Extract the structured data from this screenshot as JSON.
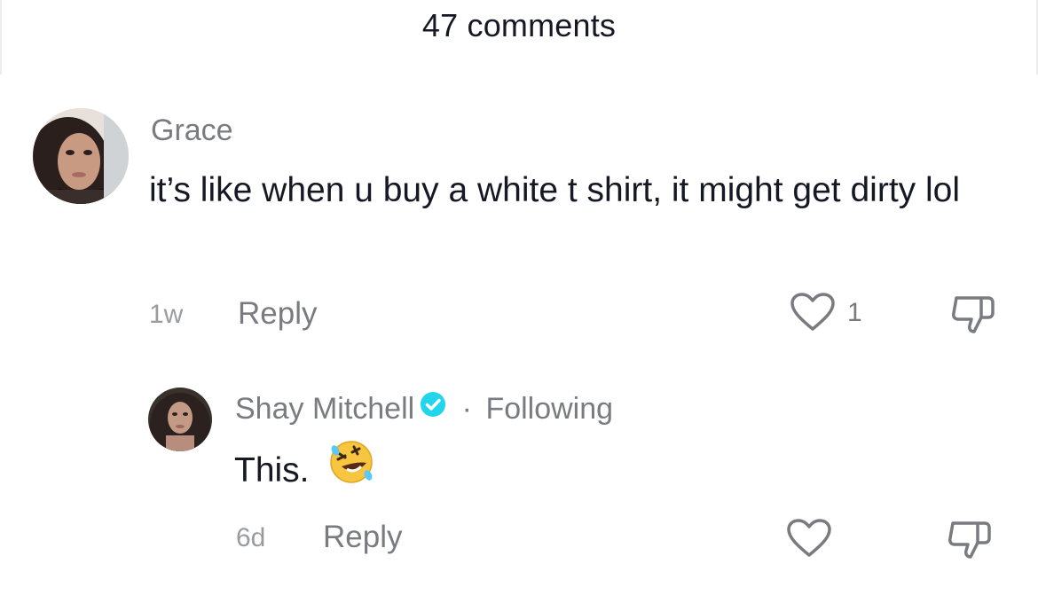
{
  "header": {
    "title": "47 comments"
  },
  "comments": [
    {
      "username": "Grace",
      "text": "it’s like when u buy a white t shirt, it might get dirty lol",
      "time": "1w",
      "reply_label": "Reply",
      "like_count": "1"
    }
  ],
  "replies": [
    {
      "username": "Shay Mitchell",
      "separator": "·",
      "following_label": "Following",
      "text": "This.",
      "emoji": "🤣",
      "time": "6d",
      "reply_label": "Reply"
    }
  ],
  "colors": {
    "verified": "#20d5ec",
    "muted_text": "#7a7b80",
    "primary_text": "#161823"
  }
}
